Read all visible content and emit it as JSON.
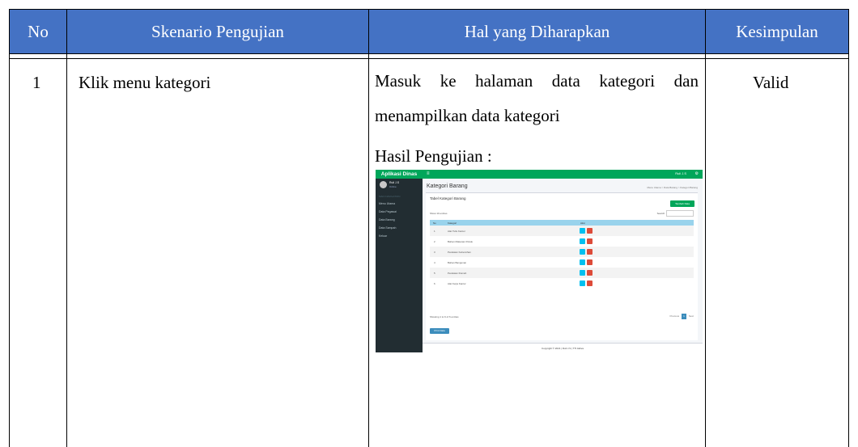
{
  "table": {
    "headers": [
      "No",
      "Skenario Pengujian",
      "Hal yang Diharapkan",
      "Kesimpulan"
    ],
    "header_color": "#4472c4",
    "rows": [
      {
        "no": "1",
        "skenario": "Klik menu kategori",
        "harapan_line1": "Masuk ke halaman data kategori dan",
        "harapan_line2": "menampilkan data kategori",
        "hasil_label": "Hasil Pengujian :",
        "kesimpulan": "Valid"
      }
    ]
  },
  "screenshot": {
    "brand": "Aplikasi Dinas",
    "user_name": "Ruli J.S",
    "user_status": "Online",
    "nav_header": "MAIN NAVIGATION",
    "nav_items": [
      "Menu Utama",
      "Data Pegawai",
      "Data Barang",
      "Data Sampah",
      "Keluar"
    ],
    "topbar_user": "Ruli J.S",
    "page_title": "Kategori Barang",
    "breadcrumb": "Menu Utama > Data Barang > Kategori Barang",
    "box_title": "Tabel Kategori Barang",
    "add_button": "Tambah Data",
    "show_entries": "Show 10 entries",
    "search_label": "Search:",
    "columns": [
      "No",
      "Kategori",
      "Aksi"
    ],
    "rows": [
      {
        "no": "1",
        "kategori": "Alat Tulis Kantor"
      },
      {
        "no": "2",
        "kategori": "Bahan Makanan Pokok"
      },
      {
        "no": "3",
        "kategori": "Peralatan Kebersihan"
      },
      {
        "no": "4",
        "kategori": "Bahan Bangunan"
      },
      {
        "no": "5",
        "kategori": "Peralatan Rumah"
      },
      {
        "no": "6",
        "kategori": "Alat Kerja Kantor"
      }
    ],
    "showing": "Showing 1 to 6 of 6 entries",
    "pager_prev": "Previous",
    "pager_page": "1",
    "pager_next": "Next",
    "print_button": "Print Data",
    "footer": "Copyright © 2021 | Ruli J.S | TTI Aktiva"
  }
}
